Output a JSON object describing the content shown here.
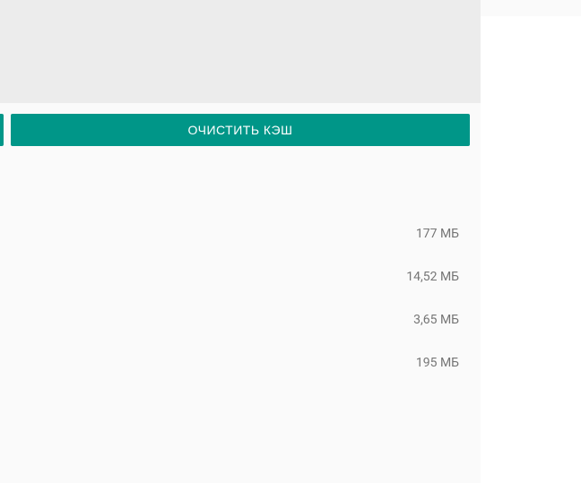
{
  "button": {
    "clear_cache_label": "ОЧИСТИТЬ КЭШ"
  },
  "storage": {
    "values": [
      "177 МБ",
      "14,52 МБ",
      "3,65 МБ",
      "195 МБ"
    ]
  }
}
